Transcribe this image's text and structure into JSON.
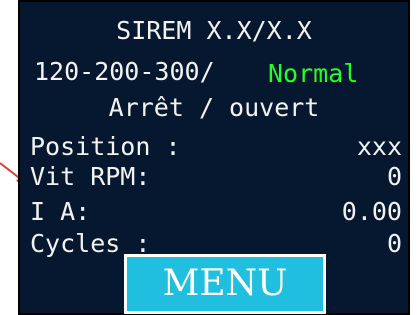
{
  "header": {
    "title": "SIREM X.X/X.X",
    "model": "120-200-300/",
    "status": "Normal",
    "state": "Arrêt / ouvert"
  },
  "readings": [
    {
      "label": "Position :",
      "value": "xxx"
    },
    {
      "label": "Vit RPM:",
      "value": "0"
    },
    {
      "label": "I A:",
      "value": "0.00"
    },
    {
      "label": "Cycles :",
      "value": "0"
    }
  ],
  "menu": {
    "label": "MENU"
  },
  "colors": {
    "screen_background": "#061830",
    "status_normal": "#22ff22",
    "menu_background": "#20bfe0",
    "arrow": "#e53935"
  },
  "icons": {
    "pointer": "arrow-pointer-icon"
  }
}
